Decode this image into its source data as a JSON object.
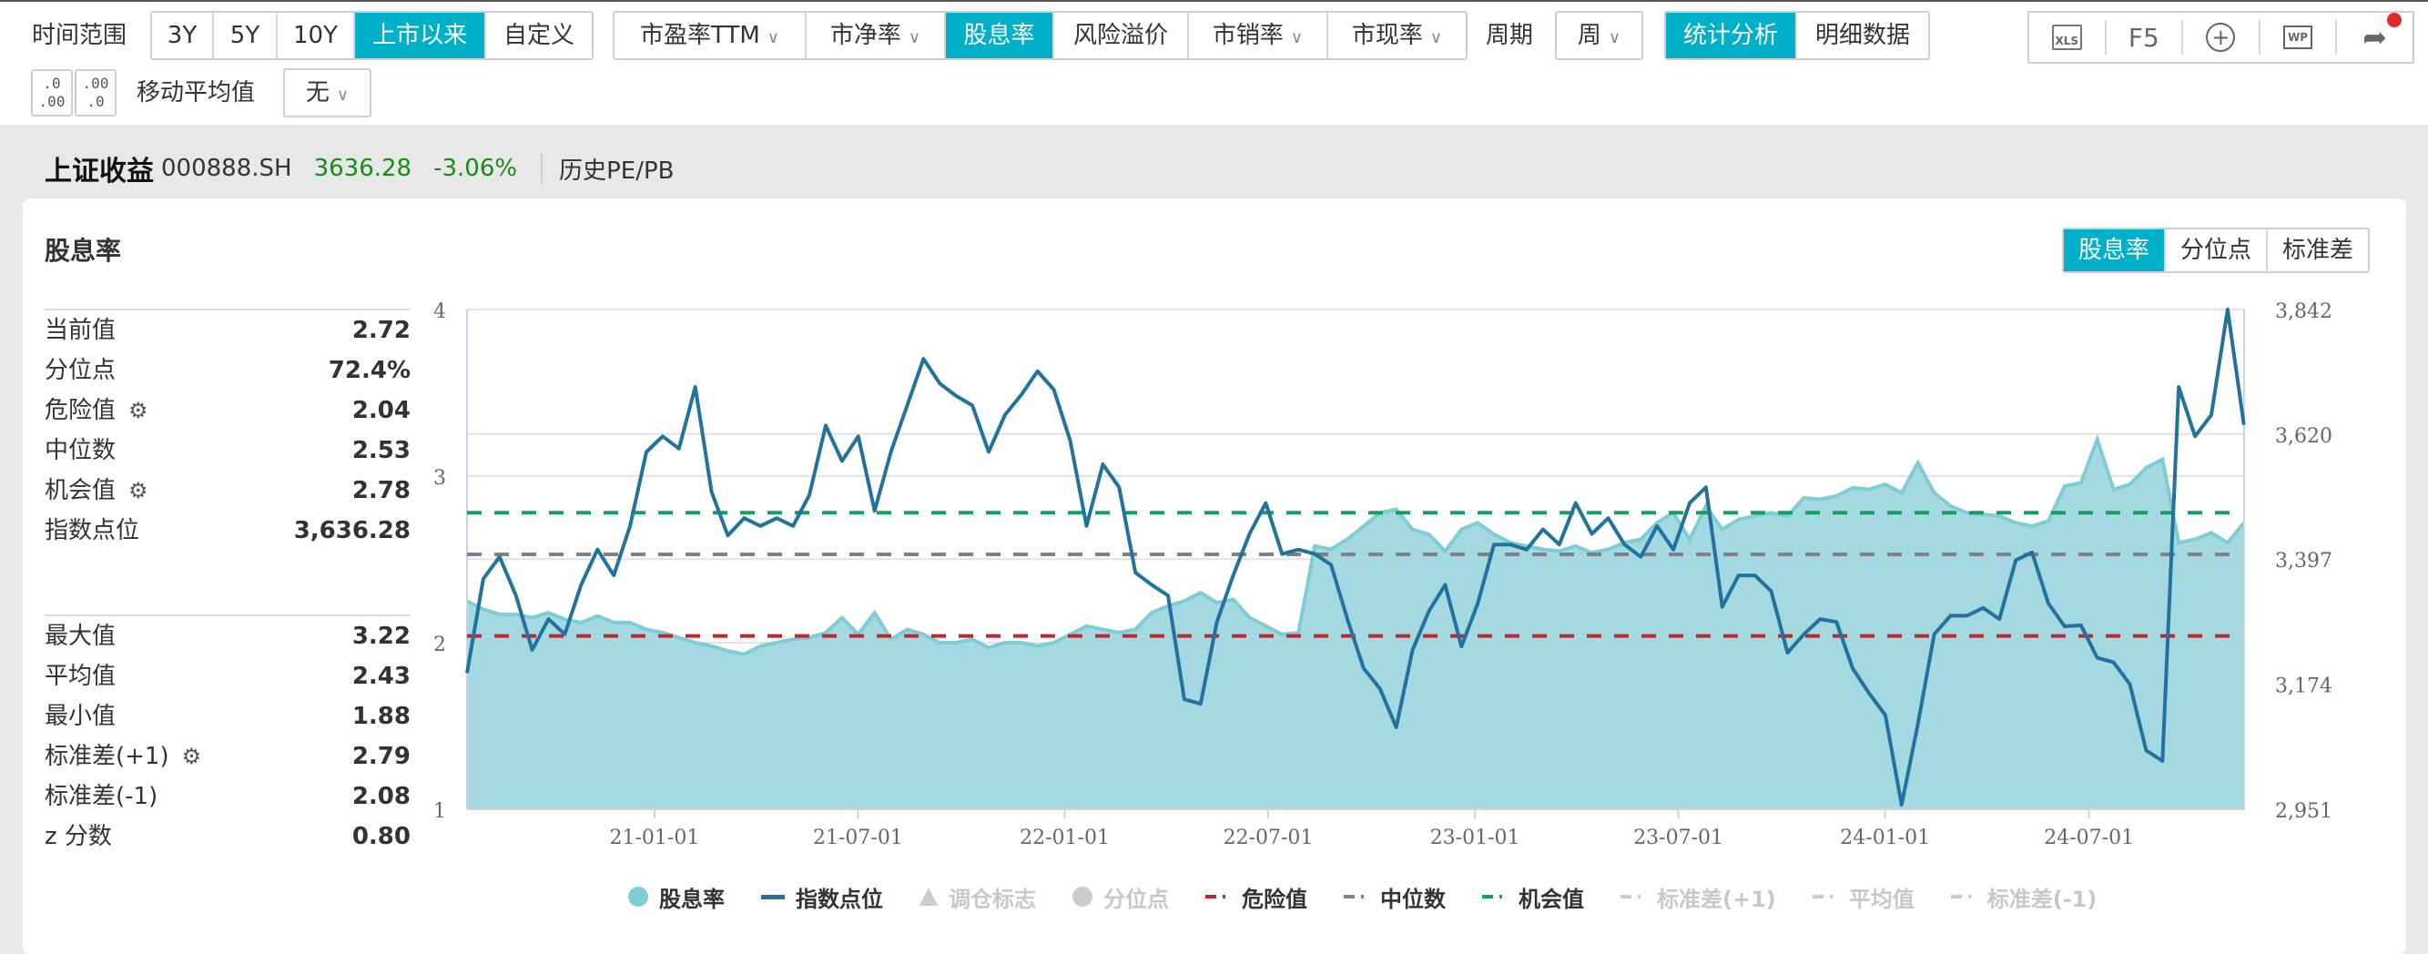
{
  "toolbar": {
    "time_range_label": "时间范围",
    "time_ranges": [
      "3Y",
      "5Y",
      "10Y",
      "上市以来",
      "自定义"
    ],
    "metrics": [
      {
        "label": "市盈率TTM",
        "dropdown": true
      },
      {
        "label": "市净率",
        "dropdown": true
      },
      {
        "label": "股息率",
        "dropdown": false
      },
      {
        "label": "风险溢价",
        "dropdown": false
      },
      {
        "label": "市销率",
        "dropdown": true
      },
      {
        "label": "市现率",
        "dropdown": true
      }
    ],
    "period_label": "周期",
    "period_value": "周",
    "views": [
      "统计分析",
      "明细数据"
    ],
    "tools": [
      "xls-export",
      "F5",
      "zoom-in",
      "wp-screen",
      "share"
    ],
    "f5_label": "F5",
    "xls_label": "XLS",
    "wp_label": "WP",
    "decimal_increase": ".0\n.00",
    "decimal_decrease": ".00\n.0",
    "ma_label": "移动平均值",
    "ma_value": "无",
    "chevron": "∨"
  },
  "header": {
    "name": "上证收益",
    "code": "000888.SH",
    "price": "3636.28",
    "change": "-3.06%",
    "link": "历史PE/PB",
    "price_color": "#1a8a1a"
  },
  "card": {
    "title": "股息率",
    "segments": [
      "股息率",
      "分位点",
      "标准差"
    ],
    "stats1": [
      {
        "label": "当前值",
        "value": "2.72"
      },
      {
        "label": "分位点",
        "value": "72.4%"
      },
      {
        "label": "危险值",
        "value": "2.04",
        "gear": true
      },
      {
        "label": "中位数",
        "value": "2.53"
      },
      {
        "label": "机会值",
        "value": "2.78",
        "gear": true
      },
      {
        "label": "指数点位",
        "value": "3,636.28"
      }
    ],
    "stats2": [
      {
        "label": "最大值",
        "value": "3.22"
      },
      {
        "label": "平均值",
        "value": "2.43"
      },
      {
        "label": "最小值",
        "value": "1.88"
      },
      {
        "label": "标准差(+1)",
        "value": "2.79",
        "gear": true
      },
      {
        "label": "标准差(-1)",
        "value": "2.08"
      },
      {
        "label": "z 分数",
        "value": "0.80"
      }
    ]
  },
  "colors": {
    "accent": "#00afc8",
    "area": "#a1d8e0",
    "area_edge": "#7ecdd5",
    "index": "#21739e",
    "danger": "#c0282d",
    "median": "#7f8087",
    "chance": "#13a05e"
  },
  "chart_data": {
    "type": "area+line",
    "x_unit": "decimal year",
    "x_start": 2020.543,
    "x_step": 0.03974,
    "xlim": [
      2020.543,
      2024.875
    ],
    "x_ticks": [
      {
        "x": 2021.0,
        "label": "21-01-01"
      },
      {
        "x": 2021.496,
        "label": "21-07-01"
      },
      {
        "x": 2022.0,
        "label": "22-01-01"
      },
      {
        "x": 2022.496,
        "label": "22-07-01"
      },
      {
        "x": 2023.0,
        "label": "23-01-01"
      },
      {
        "x": 2023.496,
        "label": "23-07-01"
      },
      {
        "x": 2024.0,
        "label": "24-01-01"
      },
      {
        "x": 2024.497,
        "label": "24-07-01"
      }
    ],
    "y_left": {
      "lim": [
        1,
        4
      ],
      "ticks": [
        "1",
        "2",
        "3",
        "4"
      ]
    },
    "y_right": {
      "lim": [
        2951,
        3842
      ],
      "ticks": [
        "2,951",
        "3,174",
        "3,397",
        "3,620",
        "3,842"
      ]
    },
    "series": [
      {
        "name": "股息率",
        "axis": "left",
        "kind": "area",
        "values": [
          2.25,
          2.2,
          2.17,
          2.17,
          2.15,
          2.18,
          2.14,
          2.12,
          2.16,
          2.12,
          2.12,
          2.08,
          2.06,
          2.03,
          2.0,
          1.98,
          1.95,
          1.93,
          1.98,
          2.0,
          2.02,
          2.03,
          2.06,
          2.15,
          2.05,
          2.18,
          2.02,
          2.08,
          2.05,
          2.0,
          2.0,
          2.02,
          1.97,
          2.0,
          2.0,
          1.98,
          2.0,
          2.05,
          2.1,
          2.08,
          2.06,
          2.08,
          2.18,
          2.22,
          2.25,
          2.3,
          2.24,
          2.26,
          2.15,
          2.1,
          2.05,
          2.06,
          2.58,
          2.56,
          2.62,
          2.7,
          2.78,
          2.8,
          2.68,
          2.65,
          2.55,
          2.68,
          2.72,
          2.65,
          2.6,
          2.58,
          2.56,
          2.55,
          2.58,
          2.54,
          2.56,
          2.6,
          2.62,
          2.72,
          2.78,
          2.62,
          2.82,
          2.68,
          2.74,
          2.76,
          2.78,
          2.76,
          2.87,
          2.86,
          2.88,
          2.93,
          2.92,
          2.95,
          2.9,
          3.08,
          2.9,
          2.82,
          2.78,
          2.77,
          2.76,
          2.72,
          2.7,
          2.73,
          2.94,
          2.96,
          3.22,
          2.92,
          2.95,
          3.05,
          3.1,
          2.6,
          2.62,
          2.66,
          2.6,
          2.72
        ]
      },
      {
        "name": "指数点位",
        "axis": "right",
        "kind": "line",
        "values": [
          3194,
          3362,
          3401,
          3332,
          3235,
          3290,
          3263,
          3351,
          3414,
          3368,
          3456,
          3588,
          3616,
          3594,
          3704,
          3517,
          3439,
          3470,
          3456,
          3470,
          3456,
          3511,
          3635,
          3572,
          3616,
          3483,
          3588,
          3671,
          3754,
          3710,
          3688,
          3671,
          3588,
          3654,
          3690,
          3732,
          3699,
          3608,
          3456,
          3566,
          3525,
          3373,
          3351,
          3332,
          3147,
          3139,
          3285,
          3368,
          3442,
          3497,
          3406,
          3414,
          3406,
          3387,
          3290,
          3202,
          3166,
          3097,
          3235,
          3304,
          3351,
          3241,
          3318,
          3423,
          3423,
          3414,
          3450,
          3423,
          3497,
          3442,
          3470,
          3423,
          3401,
          3456,
          3414,
          3497,
          3525,
          3312,
          3368,
          3368,
          3340,
          3230,
          3263,
          3290,
          3285,
          3202,
          3158,
          3119,
          2959,
          3103,
          3263,
          3296,
          3296,
          3310,
          3290,
          3395,
          3409,
          3318,
          3277,
          3279,
          3221,
          3213,
          3174,
          3056,
          3037,
          3704,
          3616,
          3654,
          3842,
          3636.28
        ]
      }
    ],
    "reference_lines": [
      {
        "name": "危险值",
        "value": 2.04,
        "color": "#c0282d"
      },
      {
        "name": "中位数",
        "value": 2.53,
        "color": "#7f8087"
      },
      {
        "name": "机会值",
        "value": 2.78,
        "color": "#13a05e"
      }
    ],
    "legend": [
      {
        "label": "股息率",
        "icon": "circle",
        "color": "#7ecdd5",
        "on": true
      },
      {
        "label": "指数点位",
        "icon": "line",
        "color": "#21739e",
        "on": true
      },
      {
        "label": "调仓标志",
        "icon": "triangle",
        "color": "#ccc",
        "on": false
      },
      {
        "label": "分位点",
        "icon": "circle",
        "color": "#ccc",
        "on": false
      },
      {
        "label": "危险值",
        "icon": "dash",
        "color": "#c0282d",
        "on": true
      },
      {
        "label": "中位数",
        "icon": "dash",
        "color": "#7f8087",
        "on": true
      },
      {
        "label": "机会值",
        "icon": "dash",
        "color": "#13a05e",
        "on": true
      },
      {
        "label": "标准差(+1)",
        "icon": "dash",
        "color": "#ccc",
        "on": false
      },
      {
        "label": "平均值",
        "icon": "dash",
        "color": "#ccc",
        "on": false
      },
      {
        "label": "标准差(-1)",
        "icon": "dash",
        "color": "#ccc",
        "on": false
      }
    ],
    "legend_position": "bottom"
  }
}
